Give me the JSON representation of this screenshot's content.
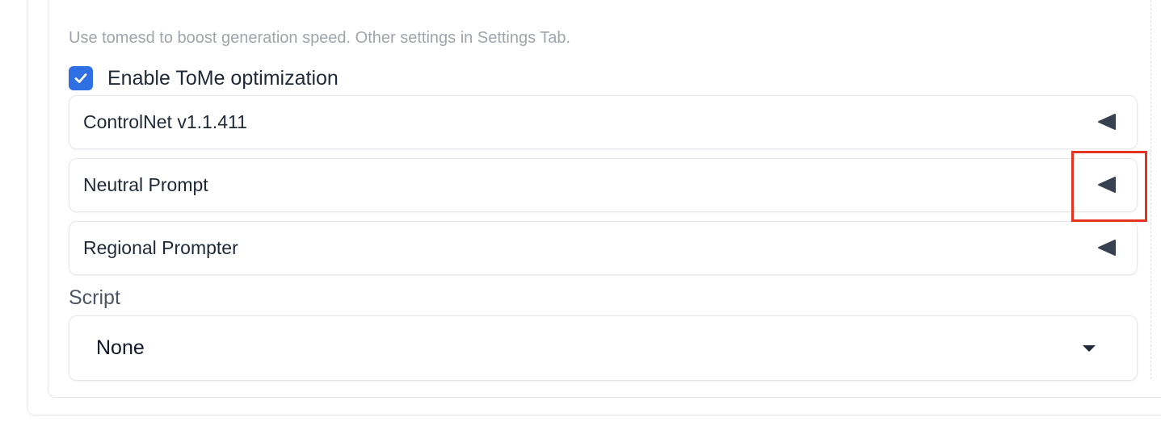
{
  "tome": {
    "hint": "Use tomesd to boost generation speed. Other settings in Settings Tab.",
    "enable_label": "Enable ToMe optimization",
    "enabled": true
  },
  "accordions": [
    {
      "label": "ControlNet v1.1.411",
      "expanded": false,
      "icon": "collapsed-triangle-icon"
    },
    {
      "label": "Neutral Prompt",
      "expanded": false,
      "icon": "collapsed-triangle-icon",
      "highlighted": true
    },
    {
      "label": "Regional Prompter",
      "expanded": false,
      "icon": "collapsed-triangle-icon"
    }
  ],
  "script": {
    "label": "Script",
    "selected": "None",
    "icon": "dropdown-caret-icon"
  },
  "colors": {
    "accent": "#2f6fe4",
    "highlight": "#e53322",
    "text": "#1f2937",
    "muted": "#a0a4ab",
    "border": "#e5e7eb"
  }
}
